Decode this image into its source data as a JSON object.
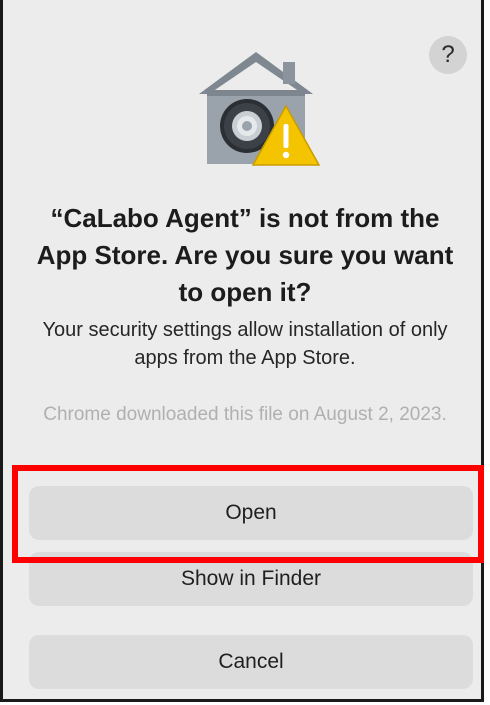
{
  "dialog": {
    "help_label": "?",
    "title": "“CaLabo Agent” is not from the App Store. Are you sure you want to open it?",
    "message": "Your security settings allow installation of only apps from the App Store.",
    "note": "Chrome downloaded this file on August 2, 2023.",
    "buttons": {
      "open": "Open",
      "show_in_finder": "Show in Finder",
      "cancel": "Cancel"
    }
  },
  "icons": {
    "app_icon": "gatekeeper-house-lock-warning-icon"
  },
  "colors": {
    "highlight": "#ff0000",
    "dialog_bg": "#ececec",
    "button_bg": "#dcdcdc",
    "warning": "#f5c400"
  }
}
